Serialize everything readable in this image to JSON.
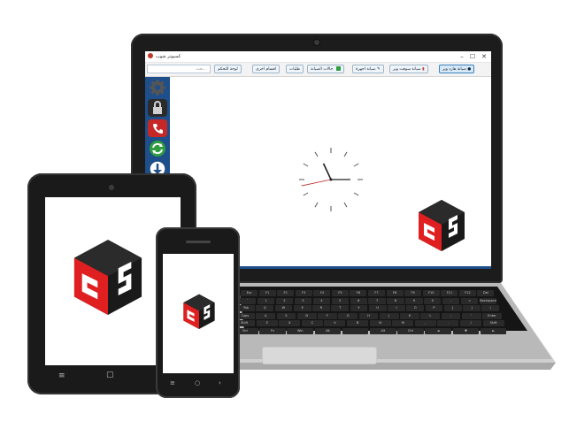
{
  "window": {
    "title": "كمبيوتر شوب",
    "minimize": "–",
    "maximize": "☐",
    "close": "✕"
  },
  "ribbon": {
    "search_placeholder": "بحث...",
    "tabs": [
      {
        "label": "لوحة التحكم"
      },
      {
        "label": "اقسام اخرى"
      },
      {
        "label": "طلبات"
      },
      {
        "label": "حالات الصيانة"
      },
      {
        "label": "صيانة اجهزة"
      },
      {
        "label": "صيانة سوفت وير"
      },
      {
        "label": "صيانة هارد وير"
      }
    ]
  },
  "sidebar": {
    "items": [
      {
        "icon": "gear-icon"
      },
      {
        "icon": "lock-icon"
      },
      {
        "icon": "phone-icon"
      },
      {
        "icon": "refresh-icon"
      },
      {
        "icon": "download-icon"
      }
    ]
  },
  "clock": {
    "hour_angle": -25,
    "minute_angle": 90,
    "second_angle": 258
  },
  "colors": {
    "brand_red": "#e02020",
    "brand_black": "#1a1a1a",
    "accent_blue": "#1e4f8a",
    "call_red": "#c62828",
    "sync_green": "#2e9e3e"
  },
  "keyboard": {
    "rows": [
      [
        "Esc",
        "F1",
        "F2",
        "F3",
        "F4",
        "F5",
        "F6",
        "F7",
        "F8",
        "F9",
        "F10",
        "F11",
        "F12",
        "Del"
      ],
      [
        "`",
        "1",
        "2",
        "3",
        "4",
        "5",
        "6",
        "7",
        "8",
        "9",
        "0",
        "-",
        "=",
        "Backspace"
      ],
      [
        "Tab",
        "Q",
        "W",
        "E",
        "R",
        "T",
        "Y",
        "U",
        "I",
        "O",
        "P",
        "[",
        "]",
        "\\"
      ],
      [
        "Caps",
        "A",
        "S",
        "D",
        "F",
        "G",
        "H",
        "J",
        "K",
        "L",
        ";",
        "'",
        "Enter"
      ],
      [
        "Shift",
        "Z",
        "X",
        "C",
        "V",
        "B",
        "N",
        "M",
        ",",
        ".",
        "/",
        "Shift"
      ],
      [
        "Ctrl",
        "Fn",
        "Win",
        "Alt",
        "",
        "Alt",
        "Ctrl",
        "◄",
        "▼",
        "►"
      ]
    ]
  }
}
